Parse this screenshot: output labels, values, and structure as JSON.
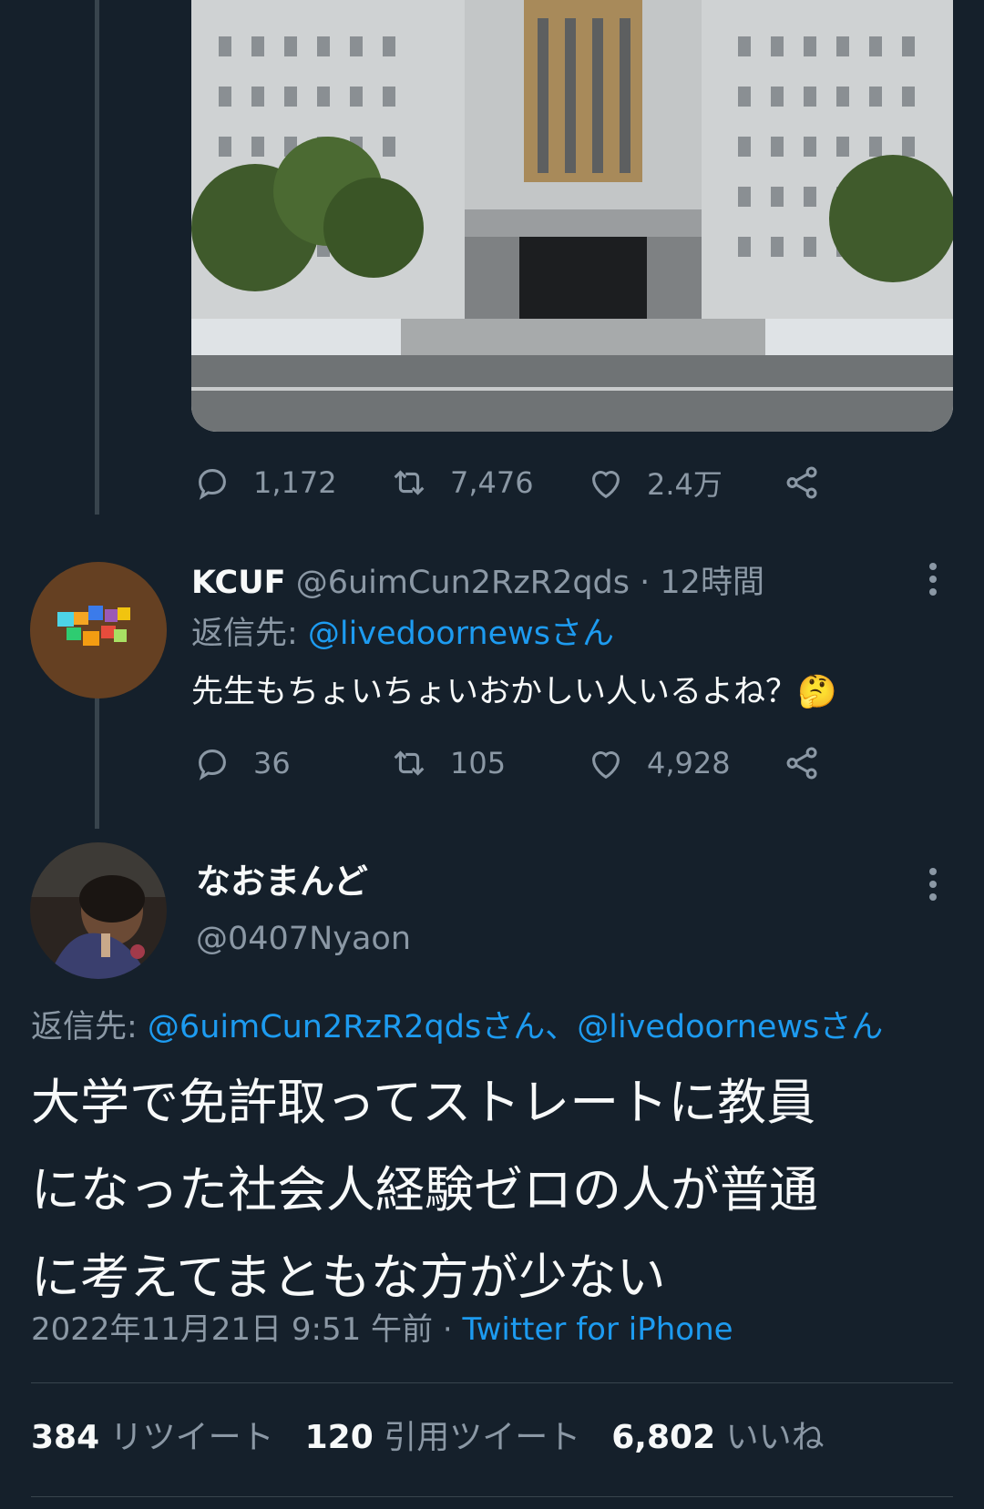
{
  "tweet1": {
    "stats": {
      "replies": "1,172",
      "retweets": "7,476",
      "likes": "2.4万"
    }
  },
  "tweet2": {
    "name": "KCUF",
    "handle": "@6uimCun2RzR2qds",
    "time": "· 12時間",
    "reply_prefix": "返信先: ",
    "reply_to": "@livedoornewsさん",
    "text": "先生もちょいちょいおかしい人いるよね？",
    "emoji": "🤔",
    "stats": {
      "replies": "36",
      "retweets": "105",
      "likes": "4,928"
    }
  },
  "tweet3": {
    "name": "なおまんど",
    "handle": "@0407Nyaon",
    "reply_prefix": "返信先: ",
    "reply_to_1": "@6uimCun2RzR2qdsさん、",
    "reply_to_2": "@livedoornewsさん",
    "text_lines": [
      "大学で免許取ってストレートに教員",
      "になった社会人経験ゼロの人が普通",
      "に考えてまともな方が少ない"
    ],
    "timestamp": "2022年11月21日 9:51 午前 · ",
    "source": "Twitter for iPhone",
    "retweet_count": "384",
    "retweet_label": "リツイート",
    "quote_count": "120",
    "quote_label": "引用ツイート",
    "like_count": "6,802",
    "like_label": "いいね"
  },
  "colors": {
    "bg": "#15202b",
    "text": "#f7f9f9",
    "muted": "#8b98a5",
    "link": "#1d9bf0",
    "border": "#38444d"
  }
}
